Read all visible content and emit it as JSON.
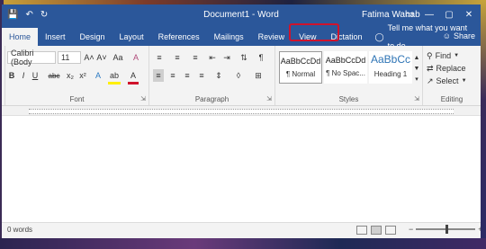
{
  "window": {
    "doc_title": "Document1 - Word",
    "user_name": "Fatima Wahab",
    "controls": [
      "▭",
      "—",
      "▢",
      "✕"
    ]
  },
  "qat": [
    "save-icon",
    "undo-icon",
    "redo-icon"
  ],
  "tabs": [
    {
      "label": "Home",
      "active": true
    },
    {
      "label": "Insert"
    },
    {
      "label": "Design"
    },
    {
      "label": "Layout"
    },
    {
      "label": "References"
    },
    {
      "label": "Mailings"
    },
    {
      "label": "Review"
    },
    {
      "label": "View"
    },
    {
      "label": "Dictation",
      "highlight_color": "#d0132c"
    }
  ],
  "tellme": "Tell me what you want to do",
  "share": "Share",
  "ribbon": {
    "font": {
      "label": "Font",
      "font_name": "Calibri (Body",
      "font_size": "11",
      "grow": "A˄",
      "shrink": "A˅",
      "change_case": "Aa",
      "clear_format": "A",
      "bold": "B",
      "italic": "I",
      "underline": "U",
      "strike": "abc",
      "subscript": "x₂",
      "superscript": "x²",
      "effects": "A",
      "highlight": "ab",
      "font_color": "A",
      "font_color_hex": "#d0132c",
      "highlight_hex": "#ffef00"
    },
    "paragraph": {
      "label": "Paragraph",
      "pilcrow": "¶"
    },
    "styles": {
      "label": "Styles",
      "items": [
        {
          "sample": "AaBbCcDd",
          "name": "¶ Normal"
        },
        {
          "sample": "AaBbCcDd",
          "name": "¶ No Spac..."
        },
        {
          "sample": "AaBbCc",
          "name": "Heading 1"
        }
      ]
    },
    "editing": {
      "label": "Editing",
      "find": "Find",
      "replace": "Replace",
      "select": "Select"
    }
  },
  "status": {
    "word_count": "0 words",
    "zoom_minus": "−",
    "zoom_plus": "+"
  },
  "colors": {
    "accent": "#2b579a",
    "dictation_outline": "#d0132c"
  }
}
